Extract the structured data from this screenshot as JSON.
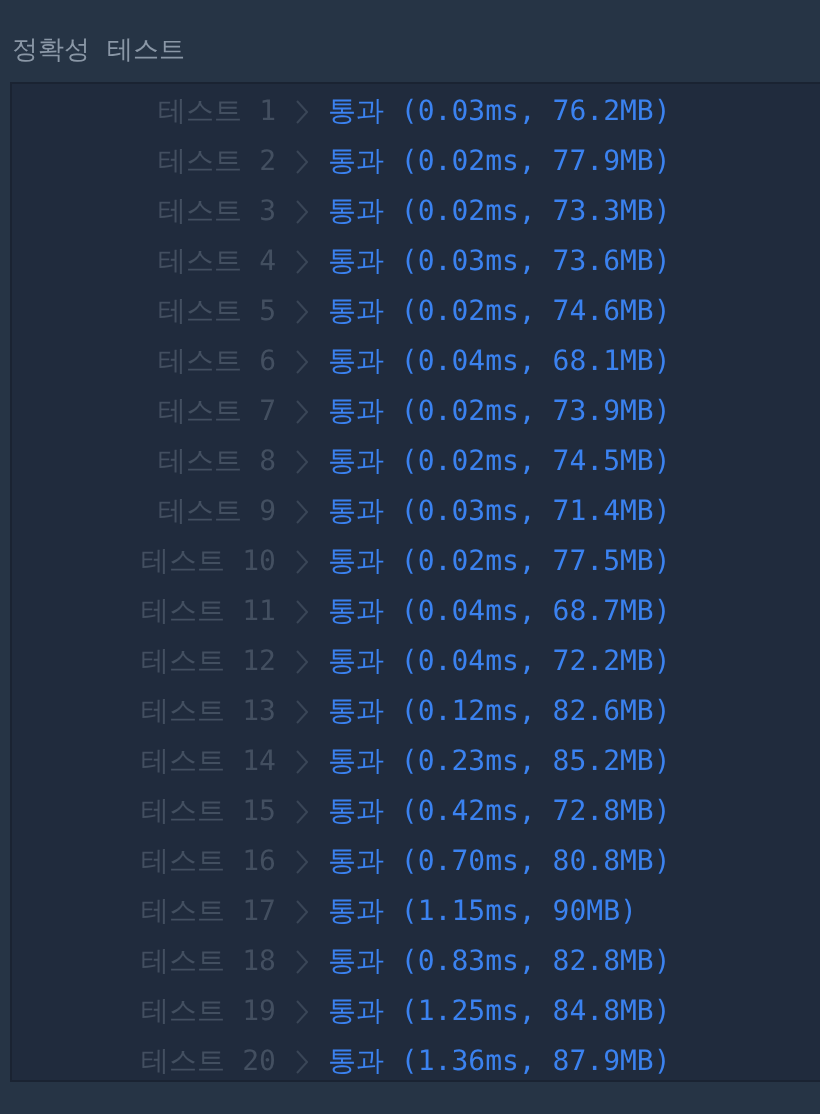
{
  "heading": {
    "title": "정확성  테스트"
  },
  "results": [
    {
      "label": "테스트 1",
      "result": "통과 (0.03ms, 76.2MB)"
    },
    {
      "label": "테스트 2",
      "result": "통과 (0.02ms, 77.9MB)"
    },
    {
      "label": "테스트 3",
      "result": "통과 (0.02ms, 73.3MB)"
    },
    {
      "label": "테스트 4",
      "result": "통과 (0.03ms, 73.6MB)"
    },
    {
      "label": "테스트 5",
      "result": "통과 (0.02ms, 74.6MB)"
    },
    {
      "label": "테스트 6",
      "result": "통과 (0.04ms, 68.1MB)"
    },
    {
      "label": "테스트 7",
      "result": "통과 (0.02ms, 73.9MB)"
    },
    {
      "label": "테스트 8",
      "result": "통과 (0.02ms, 74.5MB)"
    },
    {
      "label": "테스트 9",
      "result": "통과 (0.03ms, 71.4MB)"
    },
    {
      "label": "테스트 10",
      "result": "통과 (0.02ms, 77.5MB)"
    },
    {
      "label": "테스트 11",
      "result": "통과 (0.04ms, 68.7MB)"
    },
    {
      "label": "테스트 12",
      "result": "통과 (0.04ms, 72.2MB)"
    },
    {
      "label": "테스트 13",
      "result": "통과 (0.12ms, 82.6MB)"
    },
    {
      "label": "테스트 14",
      "result": "통과 (0.23ms, 85.2MB)"
    },
    {
      "label": "테스트 15",
      "result": "통과 (0.42ms, 72.8MB)"
    },
    {
      "label": "테스트 16",
      "result": "통과 (0.70ms, 80.8MB)"
    },
    {
      "label": "테스트 17",
      "result": "통과 (1.15ms, 90MB)"
    },
    {
      "label": "테스트 18",
      "result": "통과 (0.83ms, 82.8MB)"
    },
    {
      "label": "테스트 19",
      "result": "통과 (1.25ms, 84.8MB)"
    },
    {
      "label": "테스트 20",
      "result": "통과 (1.36ms, 87.9MB)"
    }
  ]
}
